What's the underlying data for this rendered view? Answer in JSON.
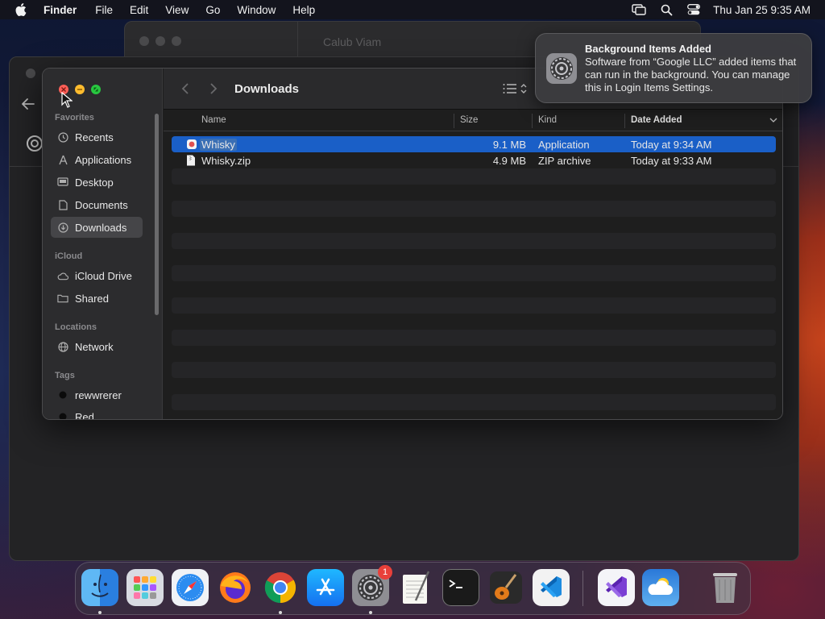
{
  "menubar": {
    "app_name": "Finder",
    "items": [
      "File",
      "Edit",
      "View",
      "Go",
      "Window",
      "Help"
    ],
    "clock": "Thu Jan 25  9:35 AM",
    "status_icons": [
      "screen-mirroring-icon",
      "search-icon",
      "control-center-icon"
    ]
  },
  "background_window": {
    "title": "Calub Viam"
  },
  "finder": {
    "title": "Downloads",
    "sidebar": {
      "favorites_label": "Favorites",
      "favorites": [
        {
          "label": "Recents",
          "icon": "clock-icon"
        },
        {
          "label": "Applications",
          "icon": "applications-icon"
        },
        {
          "label": "Desktop",
          "icon": "desktop-icon"
        },
        {
          "label": "Documents",
          "icon": "document-icon"
        },
        {
          "label": "Downloads",
          "icon": "download-icon",
          "selected": true
        }
      ],
      "icloud_label": "iCloud",
      "icloud": [
        {
          "label": "iCloud Drive",
          "icon": "cloud-icon"
        },
        {
          "label": "Shared",
          "icon": "shared-folder-icon"
        }
      ],
      "locations_label": "Locations",
      "locations": [
        {
          "label": "Network",
          "icon": "globe-icon"
        }
      ],
      "tags_label": "Tags",
      "tags": [
        {
          "label": "rewwrerer",
          "color": "#111111"
        },
        {
          "label": "Red",
          "color": "#111111"
        }
      ]
    },
    "columns": {
      "name": "Name",
      "size": "Size",
      "kind": "Kind",
      "date_added": "Date Added"
    },
    "files": [
      {
        "name": "Whisky",
        "size": "9.1 MB",
        "kind": "Application",
        "date": "Today at 9:34 AM",
        "selected": true
      },
      {
        "name": "Whisky.zip",
        "size": "4.9 MB",
        "kind": "ZIP archive",
        "date": "Today at 9:33 AM",
        "selected": false
      }
    ]
  },
  "notification": {
    "title": "Background Items Added",
    "body": "Software from “Google LLC” added items that can run in the background. You can manage this in Login Items Settings.",
    "icon": "system-settings-icon"
  },
  "dock": {
    "apps": [
      "Finder",
      "Launchpad",
      "Safari",
      "Firefox",
      "Google Chrome",
      "App Store",
      "System Settings",
      "TextEdit",
      "Terminal",
      "GarageBand",
      "Visual Studio Code",
      "Visual Studio",
      "Weather",
      "Trash"
    ],
    "settings_badge": "1"
  },
  "colors": {
    "selection": "#1a5fc7",
    "close": "#ff5f57",
    "minimize": "#febc2e",
    "maximize": "#28c840"
  }
}
